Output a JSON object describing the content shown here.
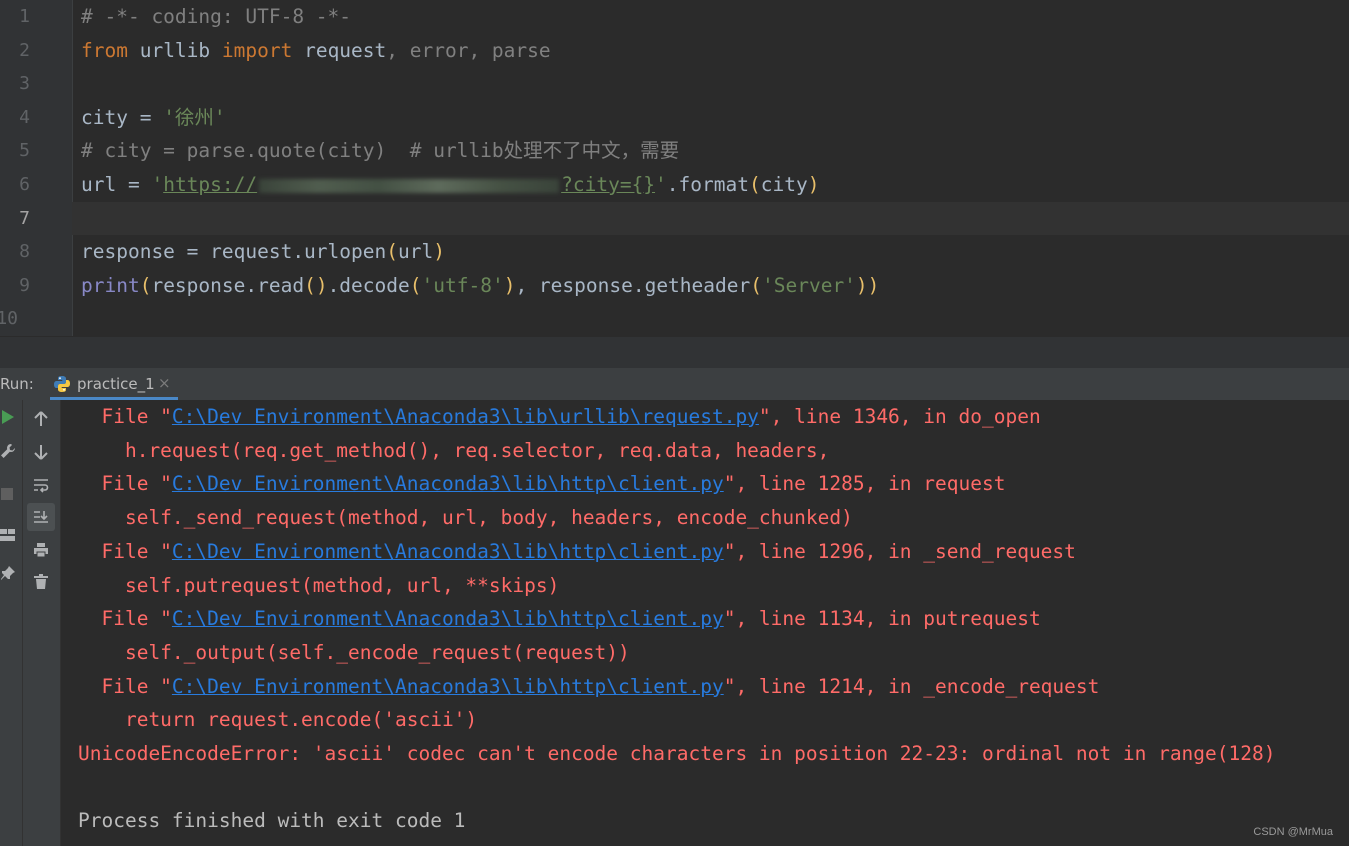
{
  "editor": {
    "line_numbers": [
      "1",
      "2",
      "3",
      "4",
      "5",
      "6",
      "7",
      "8",
      "9",
      "10"
    ],
    "line1": {
      "comment": "# -*- coding: UTF-8 -*-"
    },
    "line2": {
      "from": "from",
      "module": " urllib ",
      "import": "import",
      "name1": " request",
      "rest": ", error, parse"
    },
    "line4": {
      "var": "city = ",
      "str": "'徐州'"
    },
    "line5": {
      "comment": "# city = parse.quote(city)  # urllib处理不了中文，需要"
    },
    "line6": {
      "pre": "url = ",
      "q": "'",
      "url_start": "https://",
      "url_end": "?city={}",
      "q2": "'",
      "call": ".format",
      "open": "(",
      "arg": "city",
      "close": ")"
    },
    "line8": {
      "pre": "response = request.urlopen",
      "open": "(",
      "arg": "url",
      "close": ")"
    },
    "line9": {
      "print": "print",
      "o1": "(",
      "p1": "response.read",
      "o2": "()",
      "p2": ".decode",
      "o3": "(",
      "s1": "'utf-8'",
      "c3": ")",
      "p3": ", response.getheader",
      "o4": "(",
      "s2": "'Server'",
      "c4": "))"
    }
  },
  "run": {
    "label": "Run:",
    "tab_name": "practice_1",
    "close_glyph": "×"
  },
  "toolbar": {
    "rerun_icon": "play-icon",
    "settings_icon": "wrench-icon",
    "stop_icon": "stop-icon",
    "layout_icon": "layout-icon",
    "pin_icon": "pin-icon",
    "up_icon": "arrow-up-icon",
    "down_icon": "arrow-down-icon",
    "wrap_icon": "soft-wrap-icon",
    "scroll_icon": "scroll-to-end-icon",
    "print_icon": "print-icon",
    "trash_icon": "trash-icon"
  },
  "console": {
    "lines": [
      {
        "pre": "  File \"",
        "link": "C:\\Dev Environment\\Anaconda3\\lib\\urllib\\request.py",
        "post": "\", line 1346, in do_open"
      },
      {
        "pre": "    h.request(req.get_method(), req.selector, req.data, headers,"
      },
      {
        "pre": "  File \"",
        "link": "C:\\Dev Environment\\Anaconda3\\lib\\http\\client.py",
        "post": "\", line 1285, in request"
      },
      {
        "pre": "    self._send_request(method, url, body, headers, encode_chunked)"
      },
      {
        "pre": "  File \"",
        "link": "C:\\Dev Environment\\Anaconda3\\lib\\http\\client.py",
        "post": "\", line 1296, in _send_request"
      },
      {
        "pre": "    self.putrequest(method, url, **skips)"
      },
      {
        "pre": "  File \"",
        "link": "C:\\Dev Environment\\Anaconda3\\lib\\http\\client.py",
        "post": "\", line 1134, in putrequest"
      },
      {
        "pre": "    self._output(self._encode_request(request))"
      },
      {
        "pre": "  File \"",
        "link": "C:\\Dev Environment\\Anaconda3\\lib\\http\\client.py",
        "post": "\", line 1214, in _encode_request"
      },
      {
        "pre": "    return request.encode('ascii')"
      },
      {
        "pre": "UnicodeEncodeError: 'ascii' codec can't encode characters in position 22-23: ordinal not in range(128)"
      },
      {
        "pre": ""
      },
      {
        "pre": "Process finished with exit code 1"
      }
    ]
  },
  "colors": {
    "error": "#ff6b68",
    "link": "#287bde",
    "keyword": "#cc7832",
    "string": "#6a8759",
    "comment": "#808080"
  },
  "watermark": "CSDN @MrMua"
}
